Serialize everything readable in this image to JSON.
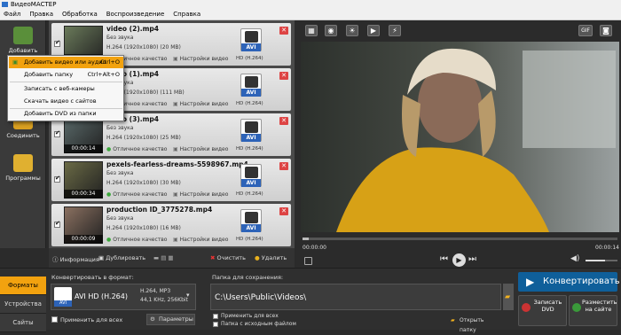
{
  "window": {
    "title": "ВидеоМАСТЕР"
  },
  "menu": [
    "Файл",
    "Правка",
    "Обработка",
    "Воспроизведение",
    "Справка"
  ],
  "sidebar": {
    "add": "Добавить",
    "join": "Соединить",
    "programs": "Программы"
  },
  "context_menu": [
    {
      "label": "Добавить видео или аудио",
      "shortcut": "Ctrl+O"
    },
    {
      "label": "Добавить папку",
      "shortcut": "Ctrl+Alt+O"
    },
    {
      "label": "Записать с веб-камеры",
      "shortcut": ""
    },
    {
      "label": "Скачать видео с сайтов",
      "shortcut": ""
    },
    {
      "label": "Добавить DVD из папки",
      "shortcut": ""
    }
  ],
  "files": [
    {
      "name": "video (2).mp4",
      "audio": "Без звука",
      "info": "H.264 (1920x1080) (20 MB)",
      "duration": "",
      "quality": "Отличное качество",
      "settings": "Настройки видео",
      "format": "AVI",
      "codec": "HD (H.264)"
    },
    {
      "name": "video (1).mp4",
      "audio": "Без звука",
      "info": "H.264 (1920x1080) (111 MB)",
      "duration": "",
      "quality": "Отличное качество",
      "settings": "Настройки видео",
      "format": "AVI",
      "codec": "HD (H.264)"
    },
    {
      "name": "video (3).mp4",
      "audio": "Без звука",
      "info": "H.264 (1920x1080) (25 MB)",
      "duration": "00:00:14",
      "quality": "Отличное качество",
      "settings": "Настройки видео",
      "format": "AVI",
      "codec": "HD (H.264)"
    },
    {
      "name": "pexels-fearless-dreams-5598967.mp4",
      "audio": "Без звука",
      "info": "H.264 (1920x1080) (30 MB)",
      "duration": "00:00:34",
      "quality": "Отличное качество",
      "settings": "Настройки видео",
      "format": "AVI",
      "codec": "HD (H.264)"
    },
    {
      "name": "production ID_3775278.mp4",
      "audio": "Без звука",
      "info": "H.264 (1920x1080) (16 MB)",
      "duration": "00:00:09",
      "quality": "Отличное качество",
      "settings": "Настройки видео",
      "format": "AVI",
      "codec": "HD (H.264)"
    }
  ],
  "listbar": {
    "info": "Информация",
    "duplicate": "Дублировать",
    "clear": "Очистить",
    "delete": "Удалить"
  },
  "player": {
    "time_start": "00:00:00",
    "time_end": "00:00:14",
    "gif": "GIF",
    "progress": 0.02,
    "volume": 0.6
  },
  "bottom": {
    "tabs": [
      "Форматы",
      "Устройства",
      "Сайты"
    ],
    "convert_label": "Конвертировать в формат:",
    "format_name": "AVI HD (H.264)",
    "format_icon_label": "AVI",
    "format_specs": [
      "H.264, MP3",
      "44,1 KHz, 256Kbit"
    ],
    "apply_all": "Применить для всех",
    "params": "Параметры",
    "save_folder_label": "Папка для сохранения:",
    "save_folder": "C:\\Users\\Public\\Videos\\",
    "apply_all2": "Применить для всех",
    "source_folder": "Папка с исходным файлом",
    "open_folder": "Открыть папку",
    "convert": "Конвертировать",
    "burn_dvd": "Записать DVD",
    "publish": "Разместить на сайте"
  }
}
